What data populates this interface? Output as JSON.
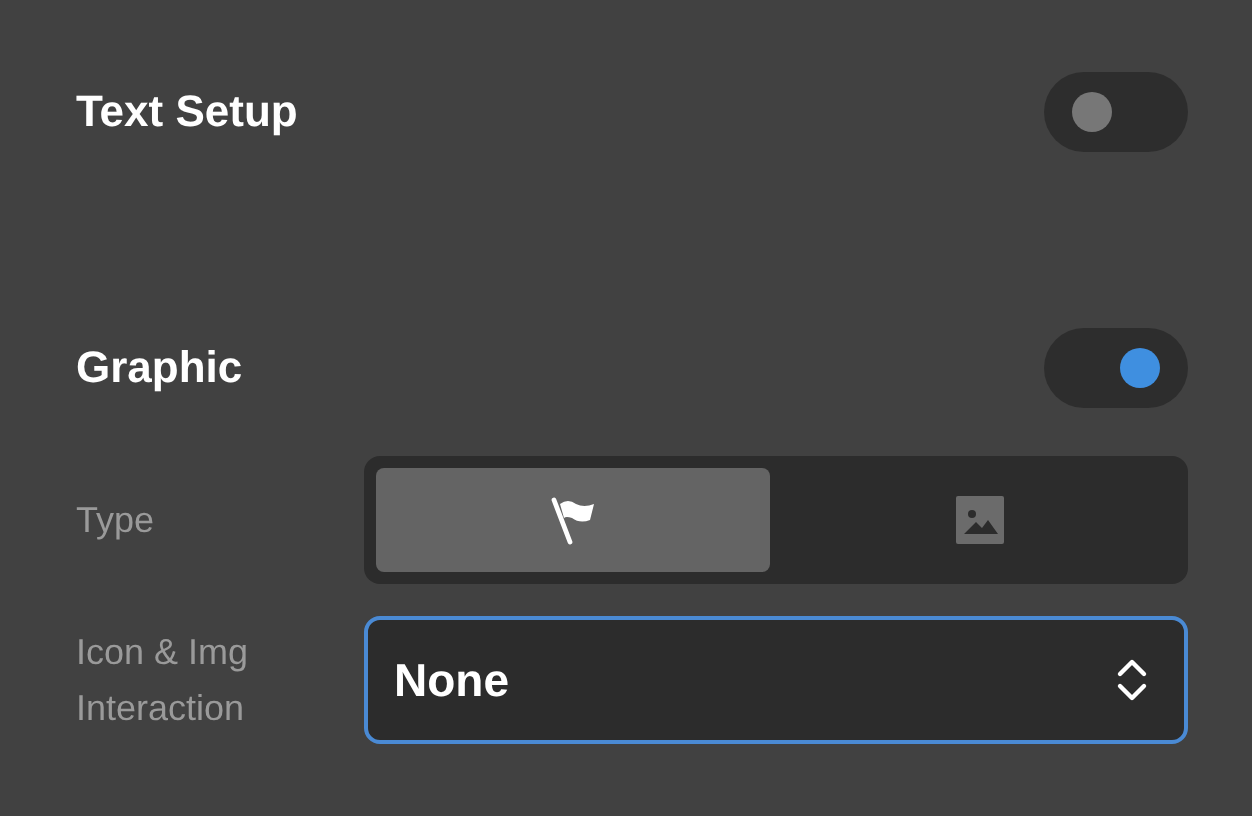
{
  "sections": [
    {
      "title": "Text Setup",
      "on": false
    },
    {
      "title": "Graphic",
      "on": true
    }
  ],
  "type_field": {
    "label": "Type",
    "options": [
      {
        "kind": "flag",
        "selected": true
      },
      {
        "kind": "image",
        "selected": false
      }
    ]
  },
  "interaction_field": {
    "label": "Icon & Img Interaction",
    "value": "None"
  }
}
